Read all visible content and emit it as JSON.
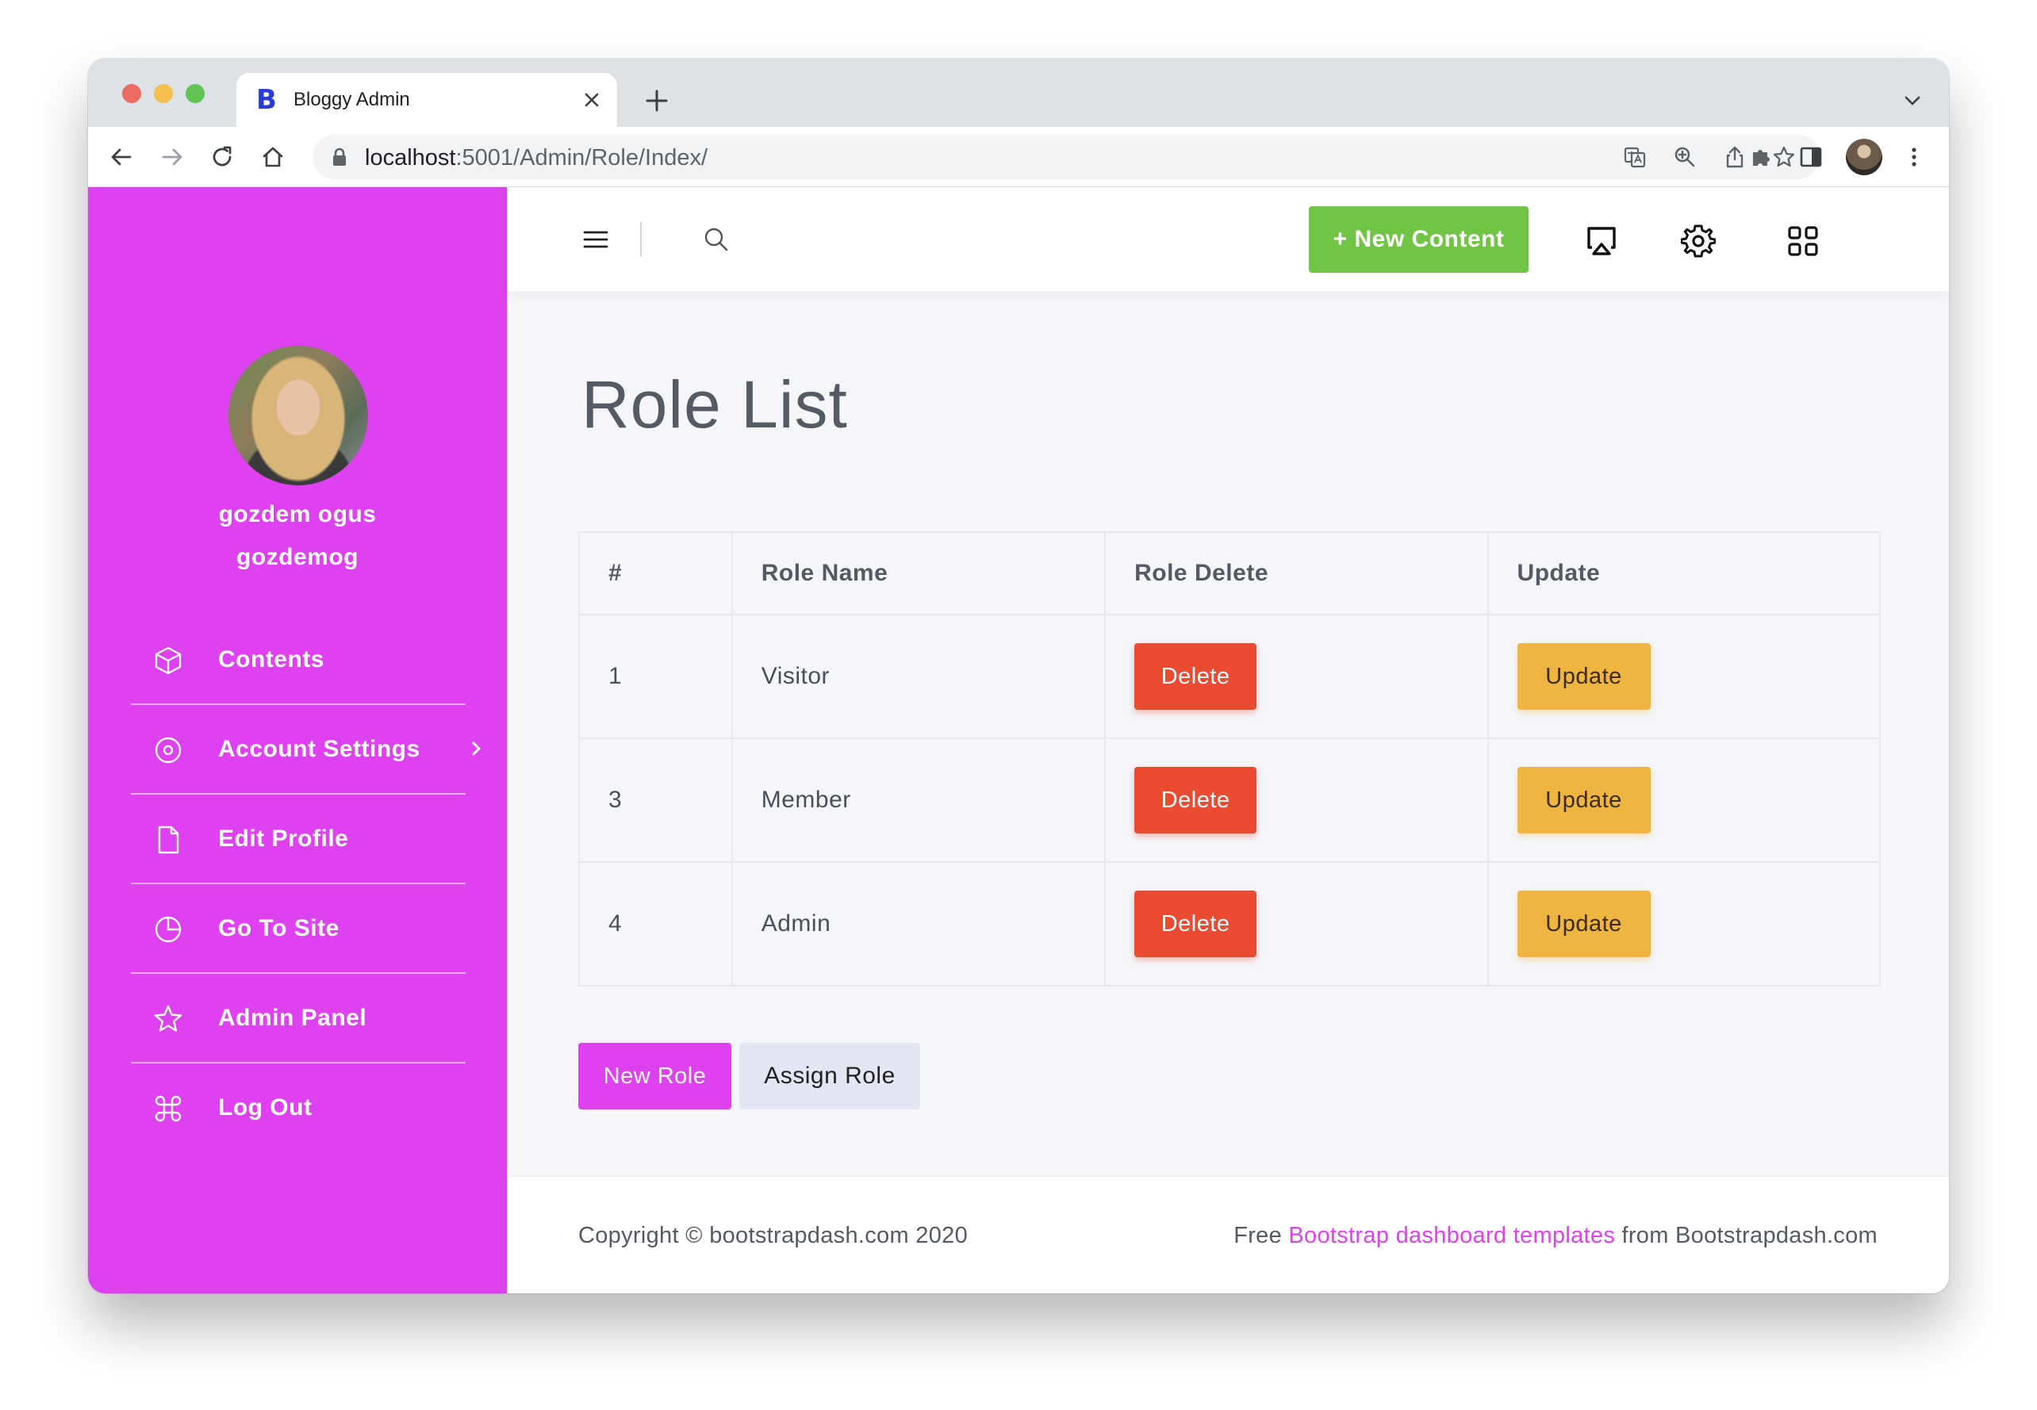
{
  "browser": {
    "tab_title": "Bloggy Admin",
    "favicon_letter": "B",
    "url_host": "localhost",
    "url_path": ":5001/Admin/Role/Index/"
  },
  "sidebar": {
    "user_name": "gozdem ogus",
    "user_handle": "gozdemog",
    "items": [
      {
        "label": "Contents",
        "icon": "cube-icon"
      },
      {
        "label": "Account Settings",
        "icon": "target-icon"
      },
      {
        "label": "Edit Profile",
        "icon": "file-icon"
      },
      {
        "label": "Go To Site",
        "icon": "pie-chart-icon"
      },
      {
        "label": "Admin Panel",
        "icon": "star-icon"
      },
      {
        "label": "Log Out",
        "icon": "command-icon"
      }
    ]
  },
  "topnav": {
    "new_content_label": "+ New Content"
  },
  "main": {
    "title": "Role List",
    "table": {
      "headers": [
        "#",
        "Role Name",
        "Role Delete",
        "Update"
      ],
      "rows": [
        {
          "id": "1",
          "name": "Visitor",
          "delete_label": "Delete",
          "update_label": "Update"
        },
        {
          "id": "3",
          "name": "Member",
          "delete_label": "Delete",
          "update_label": "Update"
        },
        {
          "id": "4",
          "name": "Admin",
          "delete_label": "Delete",
          "update_label": "Update"
        }
      ]
    },
    "new_role_label": "New Role",
    "assign_role_label": "Assign Role"
  },
  "footer": {
    "copyright": "Copyright © bootstrapdash.com 2020",
    "free_prefix": "Free ",
    "link_text": "Bootstrap dashboard templates",
    "suffix": " from Bootstrapdash.com"
  },
  "colors": {
    "sidebar": "#de41ef",
    "new_content": "#71c545",
    "delete": "#ea4b31",
    "update": "#f0b541"
  }
}
